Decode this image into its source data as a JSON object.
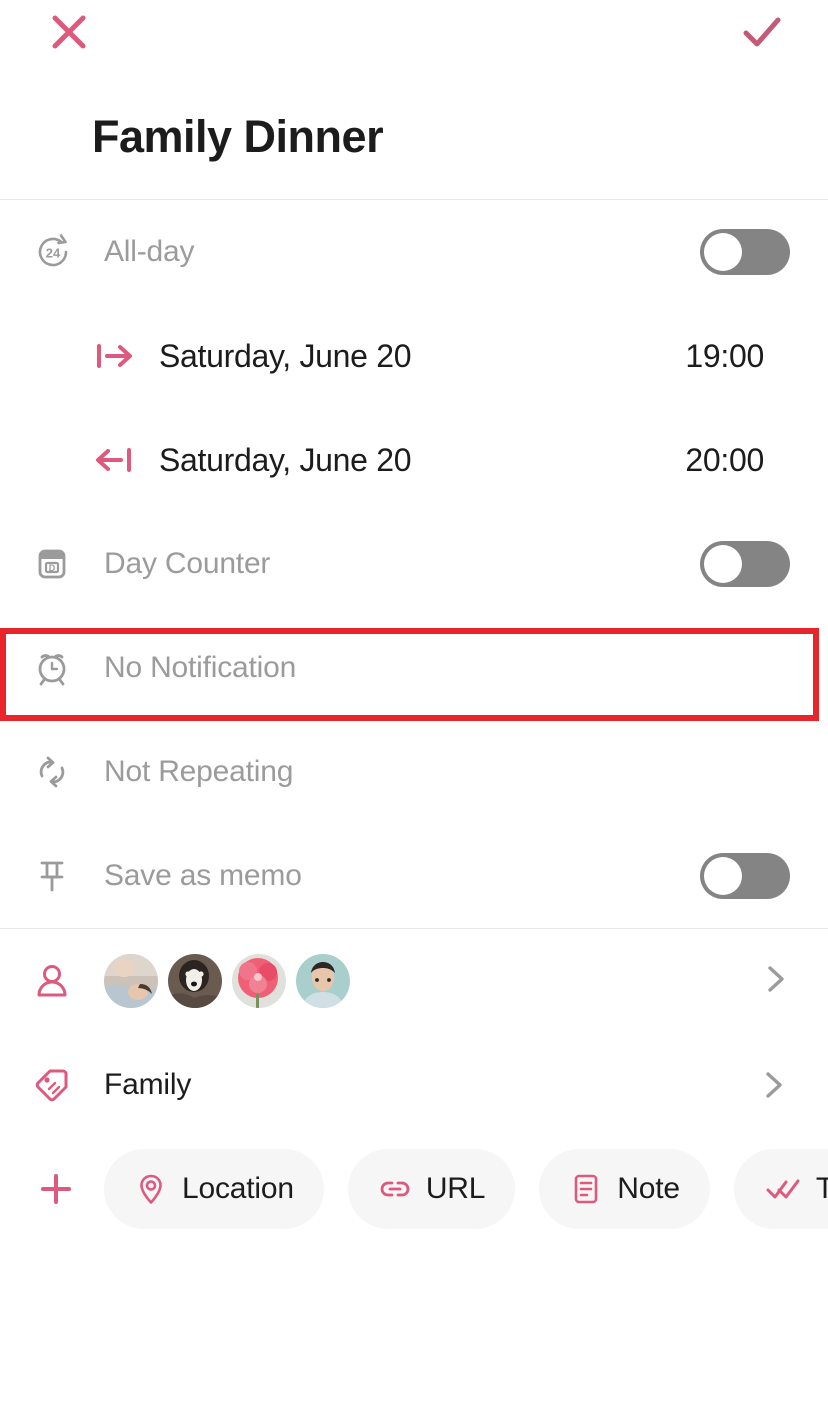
{
  "topbar": {
    "close_icon": "close-icon",
    "confirm_icon": "check-icon",
    "accent": "#dd5a7e"
  },
  "header": {
    "title": "Family Dinner"
  },
  "rows": {
    "all_day": {
      "icon": "24-hours-icon",
      "label": "All-day",
      "toggle_state": "off"
    },
    "start": {
      "icon": "arrow-right-to-bar-icon",
      "date": "Saturday, June 20",
      "time": "19:00"
    },
    "end": {
      "icon": "arrow-left-to-bar-icon",
      "date": "Saturday, June 20",
      "time": "20:00"
    },
    "day_counter": {
      "icon": "day-counter-icon",
      "label": "Day Counter",
      "toggle_state": "off"
    },
    "notification": {
      "icon": "alarm-clock-icon",
      "label": "No Notification"
    },
    "repeat": {
      "icon": "repeat-icon",
      "label": "Not Repeating"
    },
    "memo": {
      "icon": "pin-icon",
      "label": "Save as memo",
      "toggle_state": "off"
    },
    "participants": {
      "icon": "person-icon",
      "chevron": "chevron-right-icon",
      "avatars": [
        {
          "name": "avatar-person-resting",
          "bg": "#c9bcb2"
        },
        {
          "name": "avatar-dog",
          "bg": "#473c36"
        },
        {
          "name": "avatar-flower",
          "bg": "#e8556d"
        },
        {
          "name": "avatar-person-portrait",
          "bg": "#a9cbcb"
        }
      ]
    },
    "category": {
      "icon": "tag-icon",
      "label": "Family",
      "chevron": "chevron-right-icon"
    }
  },
  "attachments": {
    "add_icon": "plus-icon",
    "chips": [
      {
        "icon": "location-pin-icon",
        "label": "Location"
      },
      {
        "icon": "link-icon",
        "label": "URL"
      },
      {
        "icon": "note-icon",
        "label": "Note"
      },
      {
        "icon": "double-check-icon",
        "label": "To-Do List"
      }
    ]
  },
  "highlight": {
    "target": "No Notification",
    "color": "#e7252a"
  }
}
